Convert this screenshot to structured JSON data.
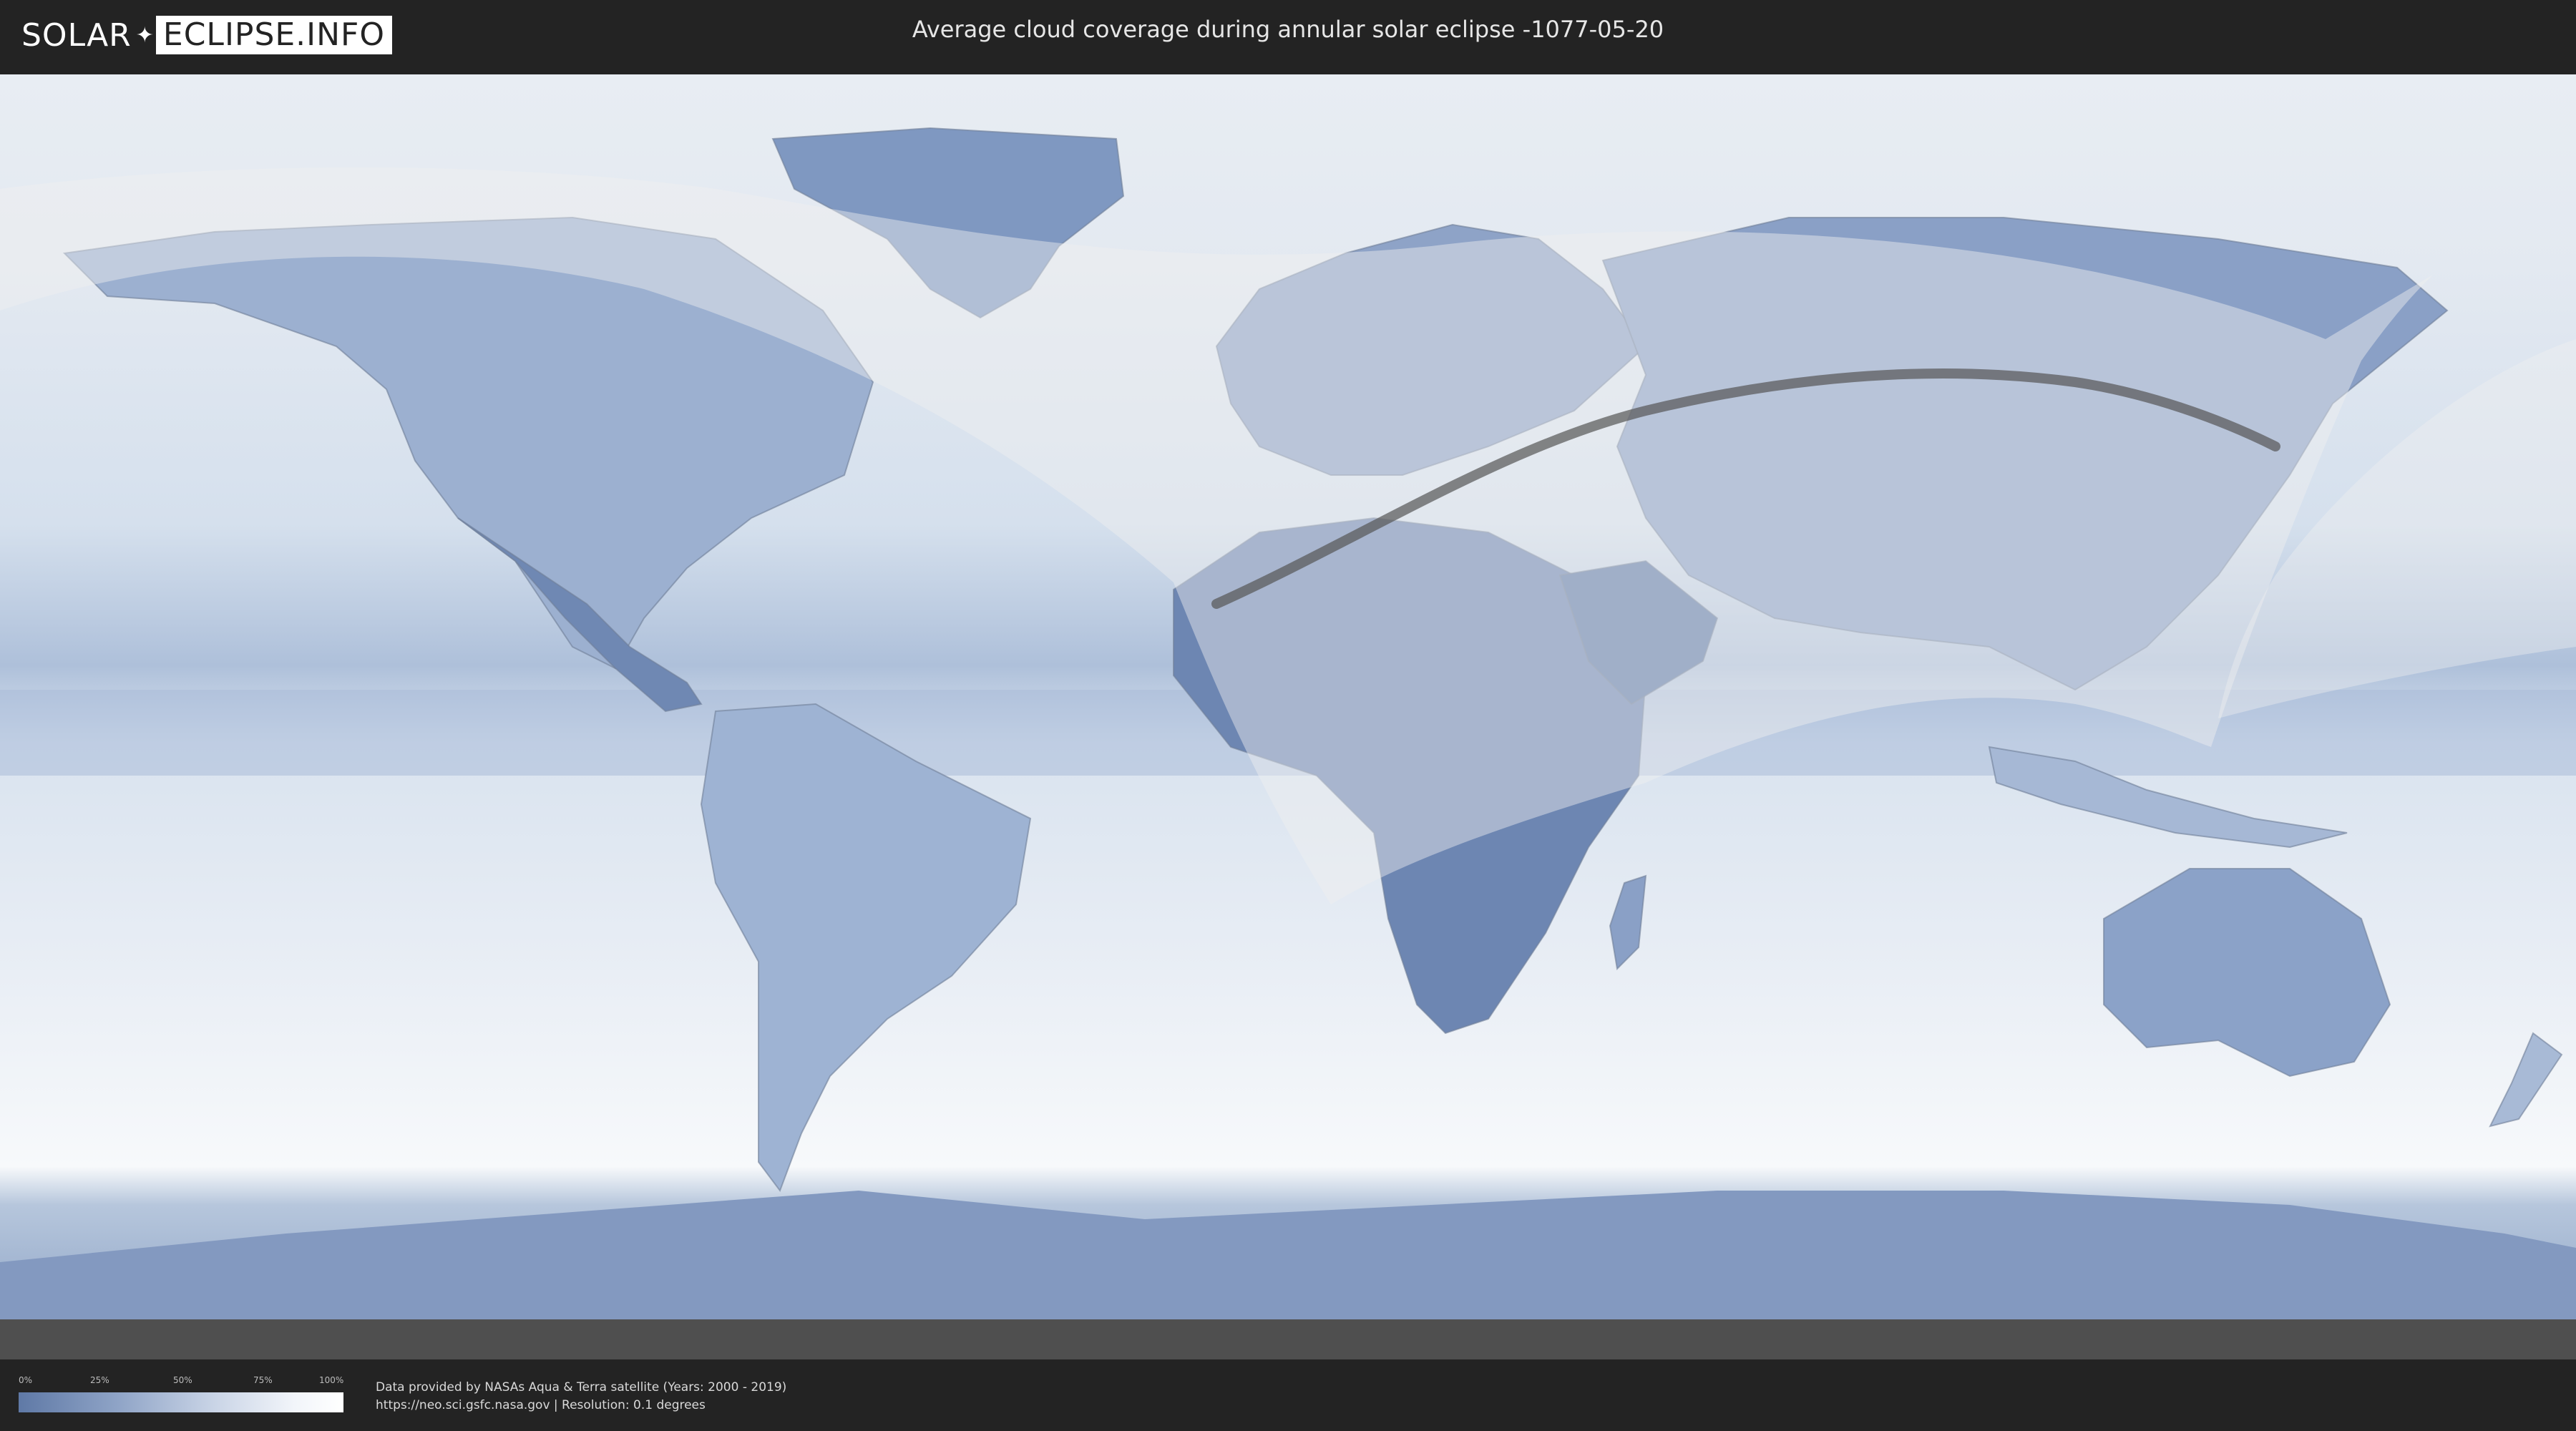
{
  "header": {
    "logo_part1": "SOLAR",
    "logo_part2": "ECLIPSE.INFO",
    "title": "Average cloud coverage during annular solar eclipse -1077-05-20"
  },
  "legend": {
    "ticks": [
      "0%",
      "25%",
      "50%",
      "75%",
      "100%"
    ],
    "colors": {
      "low": "#5f79a6",
      "high": "#ffffff"
    }
  },
  "footer": {
    "credit_line1": "Data provided by NASAs Aqua & Terra satellite (Years: 2000 - 2019)",
    "credit_line2": "https://neo.sci.gsfc.nasa.gov | Resolution: 0.1 degrees"
  },
  "map": {
    "projection": "equirectangular",
    "ocean_color": "#dbe4ef",
    "land_cloud_color": "#7d95bd",
    "eclipse_zone_color": "#f0f0f0",
    "path_color": "#555555"
  }
}
